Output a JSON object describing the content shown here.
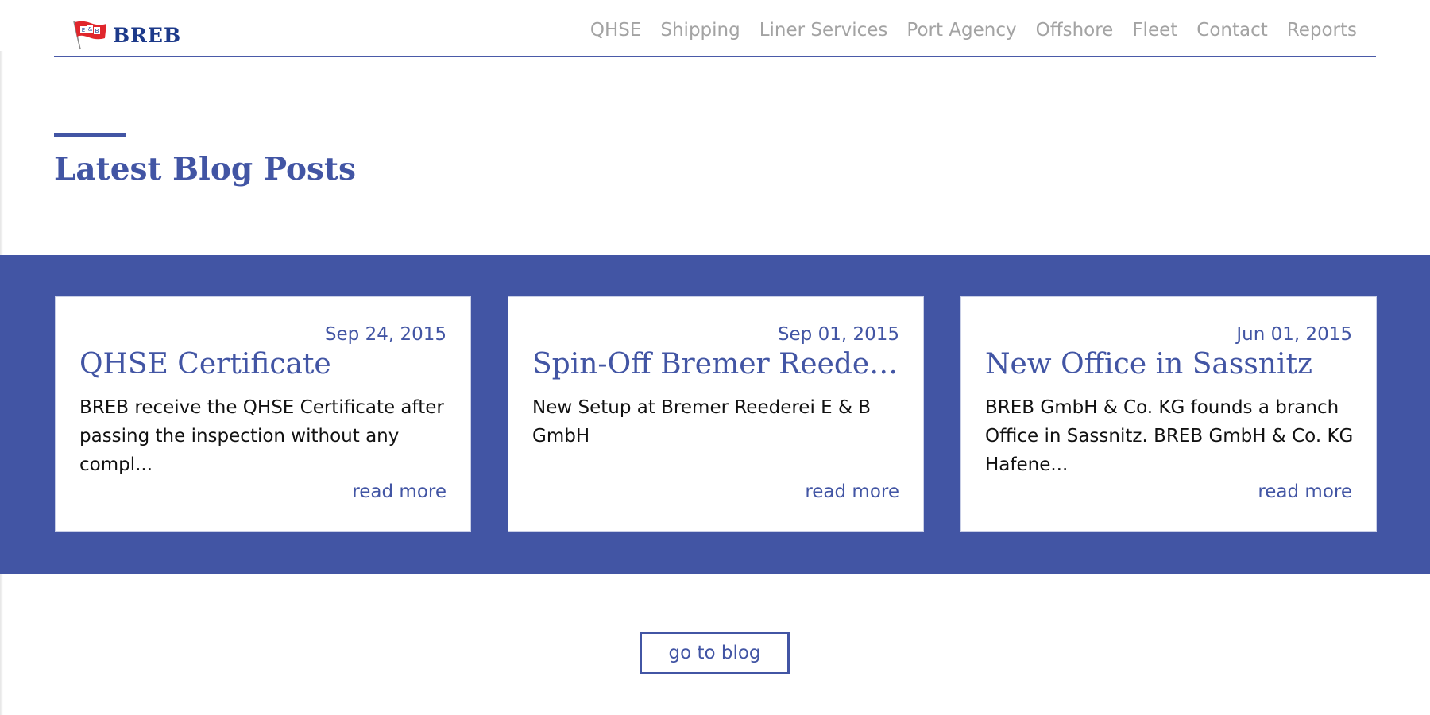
{
  "header": {
    "logo_text": "BREB",
    "logo_flag_letters": [
      "E",
      "&",
      "B"
    ],
    "nav": [
      "QHSE",
      "Shipping",
      "Liner Services",
      "Port Agency",
      "Offshore",
      "Fleet",
      "Contact",
      "Reports"
    ]
  },
  "section": {
    "title": "Latest Blog Posts"
  },
  "posts": [
    {
      "date": "Sep 24, 2015",
      "title": "QHSE Certificate",
      "excerpt": "BREB receive the QHSE Certificate after passing the inspection without any compl...",
      "more": "read more"
    },
    {
      "date": "Sep 01, 2015",
      "title": "Spin-Off Bremer Reederei ...",
      "excerpt": "New Setup at Bremer Reederei E & B GmbH",
      "more": "read more"
    },
    {
      "date": "Jun 01, 2015",
      "title": "New Office in Sassnitz",
      "excerpt": "BREB GmbH & Co. KG founds a branch Office in Sassnitz. BREB GmbH & Co. KG Hafene...",
      "more": "read more"
    }
  ],
  "blog_button": "go to blog",
  "colors": {
    "accent": "#4255a4",
    "logo_text": "#1d3a8a",
    "flag_red": "#e0262c",
    "nav_text": "#a3a3a3",
    "body_text": "#111111"
  }
}
